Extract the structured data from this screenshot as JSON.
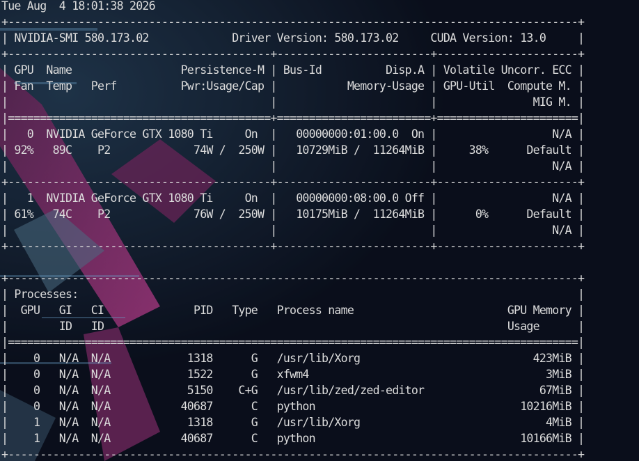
{
  "theme": {
    "foreground": "#dcdcdc",
    "background": "#0b0f1c",
    "wallpaper_accent": "#8a2a6e"
  },
  "terminal": {
    "lines": [
      "Tue Aug  4 18:01:38 2026",
      "+-----------------------------------------------------------------------------------------+",
      "| NVIDIA-SMI 580.173.02             Driver Version: 580.173.02     CUDA Version: 13.0     |",
      "+-----------------------------------------+------------------------+----------------------+",
      "| GPU  Name                 Persistence-M | Bus-Id          Disp.A | Volatile Uncorr. ECC |",
      "| Fan  Temp   Perf          Pwr:Usage/Cap |           Memory-Usage | GPU-Util  Compute M. |",
      "|                                         |                        |               MIG M. |",
      "|=========================================+========================+======================|",
      "|   0  NVIDIA GeForce GTX 1080 Ti     On  |   00000000:01:00.0  On |                  N/A |",
      "| 92%   89C    P2             74W /  250W |   10729MiB /  11264MiB |     38%      Default |",
      "|                                         |                        |                  N/A |",
      "+-----------------------------------------+------------------------+----------------------+",
      "|   1  NVIDIA GeForce GTX 1080 Ti     On  |   00000000:08:00.0 Off |                  N/A |",
      "| 61%   74C    P2             76W /  250W |   10175MiB /  11264MiB |      0%      Default |",
      "|                                         |                        |                  N/A |",
      "+-----------------------------------------+------------------------+----------------------+",
      "",
      "+-----------------------------------------------------------------------------------------+",
      "| Processes:                                                                              |",
      "|  GPU   GI   CI              PID   Type   Process name                        GPU Memory |",
      "|        ID   ID                                                               Usage      |",
      "|=========================================================================================|",
      "|    0   N/A  N/A            1318      G   /usr/lib/Xorg                           423MiB |",
      "|    0   N/A  N/A            1522      G   xfwm4                                     3MiB |",
      "|    0   N/A  N/A            5150    C+G   /usr/lib/zed/zed-editor                  67MiB |",
      "|    0   N/A  N/A           40687      C   python                                10216MiB |",
      "|    1   N/A  N/A            1318      G   /usr/lib/Xorg                             4MiB |",
      "|    1   N/A  N/A           40687      C   python                                10166MiB |",
      "+-----------------------------------------------------------------------------------------+"
    ]
  }
}
